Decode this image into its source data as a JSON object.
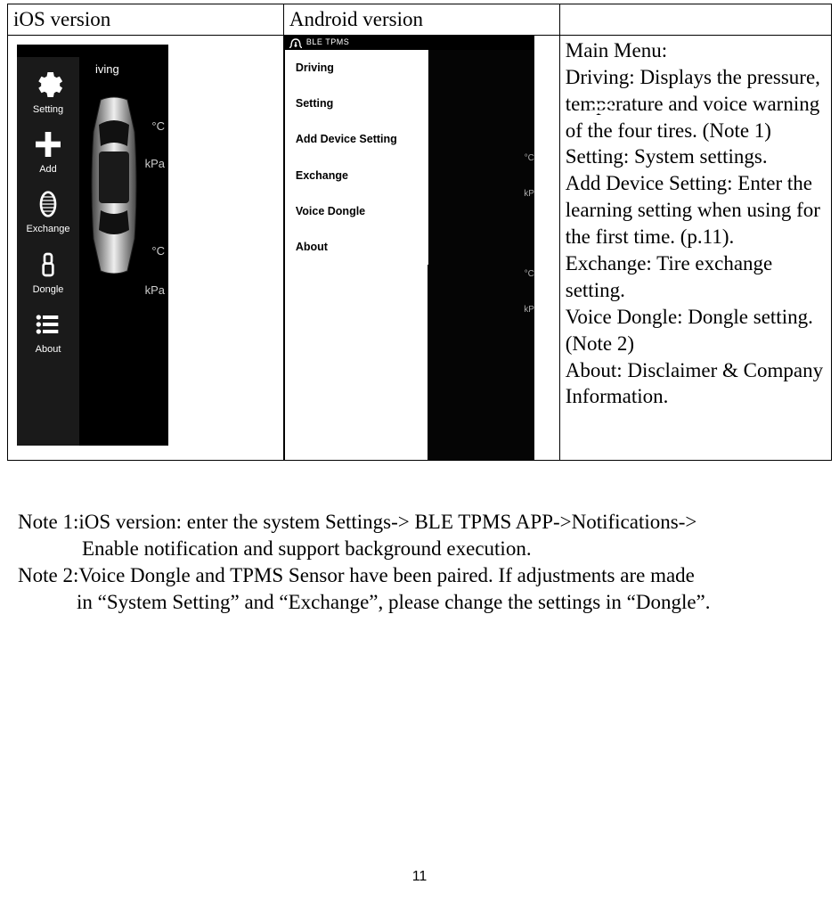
{
  "header": {
    "col_ios": "iOS version",
    "col_android": "Android version",
    "col_desc": ""
  },
  "ios": {
    "driving_label": "iving",
    "sidebar": [
      {
        "label": "Setting"
      },
      {
        "label": "Add"
      },
      {
        "label": "Exchange"
      },
      {
        "label": "Dongle"
      },
      {
        "label": "About"
      }
    ],
    "units": {
      "temp": "°C",
      "press": "kPa"
    }
  },
  "android": {
    "status_title": "BLE TPMS",
    "drawer": [
      "Driving",
      "Setting",
      "Add  Device Setting",
      "Exchange",
      "Voice Dongle",
      "About"
    ],
    "units": {
      "temp": "°C",
      "press": "kP"
    }
  },
  "desc": {
    "title": "Main Menu:",
    "items": [
      "Driving: Displays the pressure, temperature and voice warning of the four tires. (Note 1)",
      "Setting: System settings.",
      "Add Device Setting: Enter the learning setting when using for the first time. (p.11).",
      "Exchange: Tire exchange setting.",
      "Voice Dongle: Dongle setting. (Note 2)",
      "About: Disclaimer & Company Information."
    ]
  },
  "notes": {
    "n1_label": "Note 1: ",
    "n1_line1": "iOS version: enter the system Settings-> BLE TPMS APP->Notifications->",
    "n1_line2": "Enable notification and support background execution.",
    "n2_label": "Note 2: ",
    "n2_line1": "Voice Dongle and TPMS Sensor have been paired. If adjustments are made",
    "n2_line2": "in “System Setting” and “Exchange”, please change the settings in “Dongle”."
  },
  "page_number": "11"
}
